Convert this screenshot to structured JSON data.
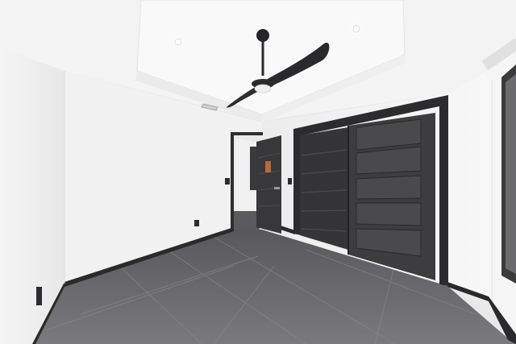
{
  "scene": {
    "subject": "empty-bedroom-interior",
    "colors": {
      "wall": "#f2f2f2",
      "wall_shade": "#e6e6e6",
      "ceiling": "#f6f6f6",
      "floor": "#6f6f72",
      "floor_dark": "#5c5c60",
      "trim": "#2c2c2e",
      "door": "#3a3a3c",
      "door_panel": "#4a4a4d",
      "fan": "#2a2a2c"
    }
  }
}
